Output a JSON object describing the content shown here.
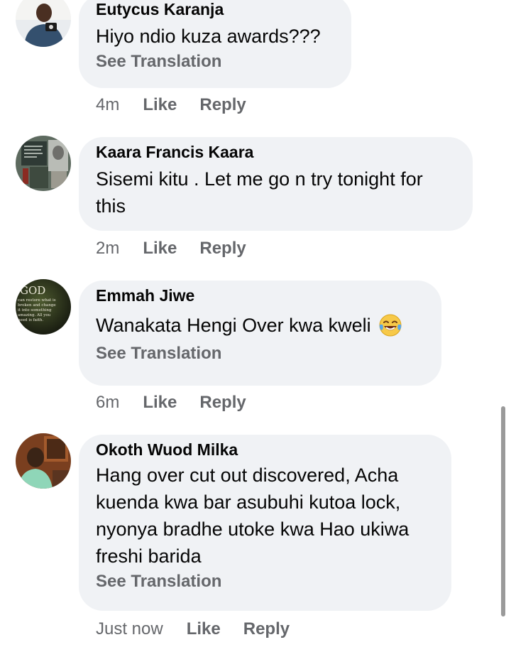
{
  "comments": [
    {
      "author": "Eutycus Karanja",
      "text": "Hiyo ndio kuza awards???",
      "see_translation": "See Translation",
      "time": "4m",
      "like": "Like",
      "reply": "Reply"
    },
    {
      "author": "Kaara Francis Kaara",
      "text_line1": "Sisemi kitu . Let me go n try tonight for",
      "text_line2": "this",
      "time": "2m",
      "like": "Like",
      "reply": "Reply"
    },
    {
      "author": "Emmah Jiwe",
      "text": "Wanakata Hengi Over kwa kweli",
      "emoji": "face-with-tears-of-joy-icon",
      "see_translation": "See Translation",
      "time": "6m",
      "like": "Like",
      "reply": "Reply",
      "avatar_text": {
        "title": "GOD",
        "lines": [
          "can restore what is",
          "broken and change",
          "it into something",
          "amazing. All you",
          "need is faith."
        ]
      }
    },
    {
      "author": "Okoth Wuod Milka",
      "lines": [
        "Hang over cut out discovered, Acha",
        "kuenda kwa bar asubuhi kutoa lock,",
        "nyonya bradhe utoke kwa Hao ukiwa",
        "freshi barida"
      ],
      "see_translation": "See Translation",
      "time": "Just now",
      "like": "Like",
      "reply": "Reply"
    }
  ],
  "colors": {
    "bubble": "#f0f2f5",
    "secondary_text": "#65676b",
    "primary_text": "#050505",
    "scrollbar": "#9a9a9a"
  }
}
